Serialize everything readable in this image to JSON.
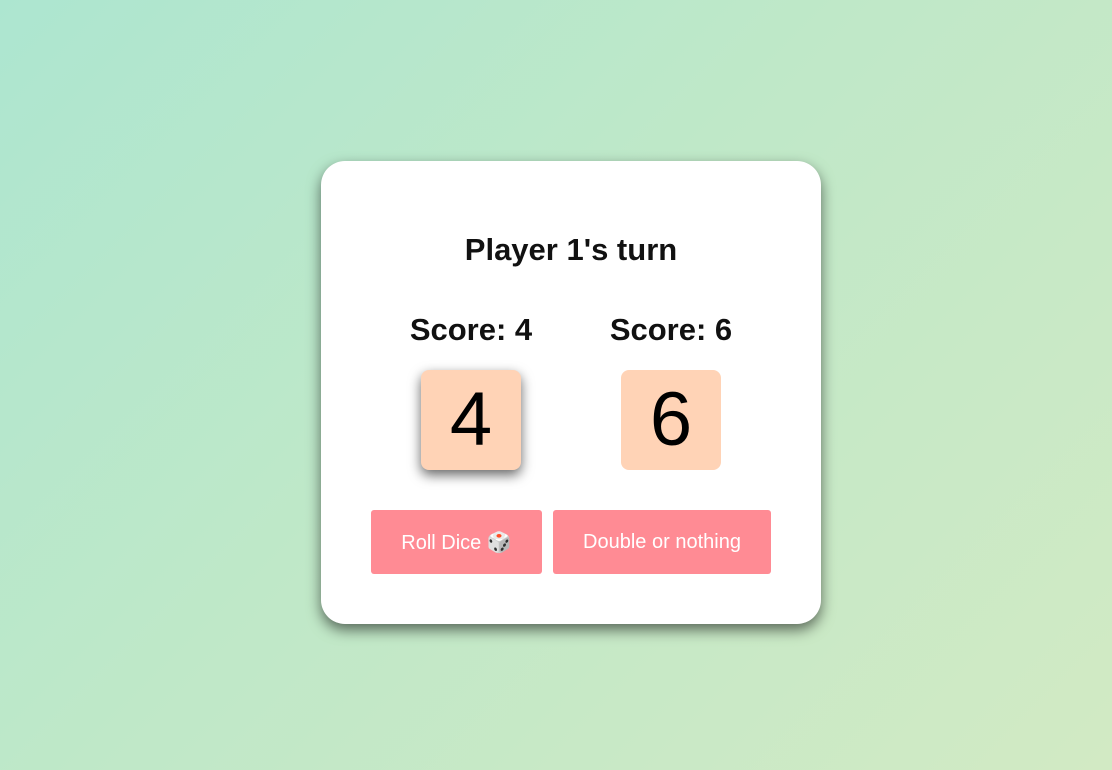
{
  "game": {
    "turn_text": "Player 1's turn",
    "players": [
      {
        "score_text": "Score: 4",
        "die_value": "4",
        "active": true
      },
      {
        "score_text": "Score: 6",
        "die_value": "6",
        "active": false
      }
    ],
    "buttons": {
      "roll": "Roll Dice 🎲",
      "double": "Double or nothing"
    }
  },
  "colors": {
    "die_face": "#ffd3b6",
    "button": "#ff8b94",
    "card": "#ffffff"
  }
}
